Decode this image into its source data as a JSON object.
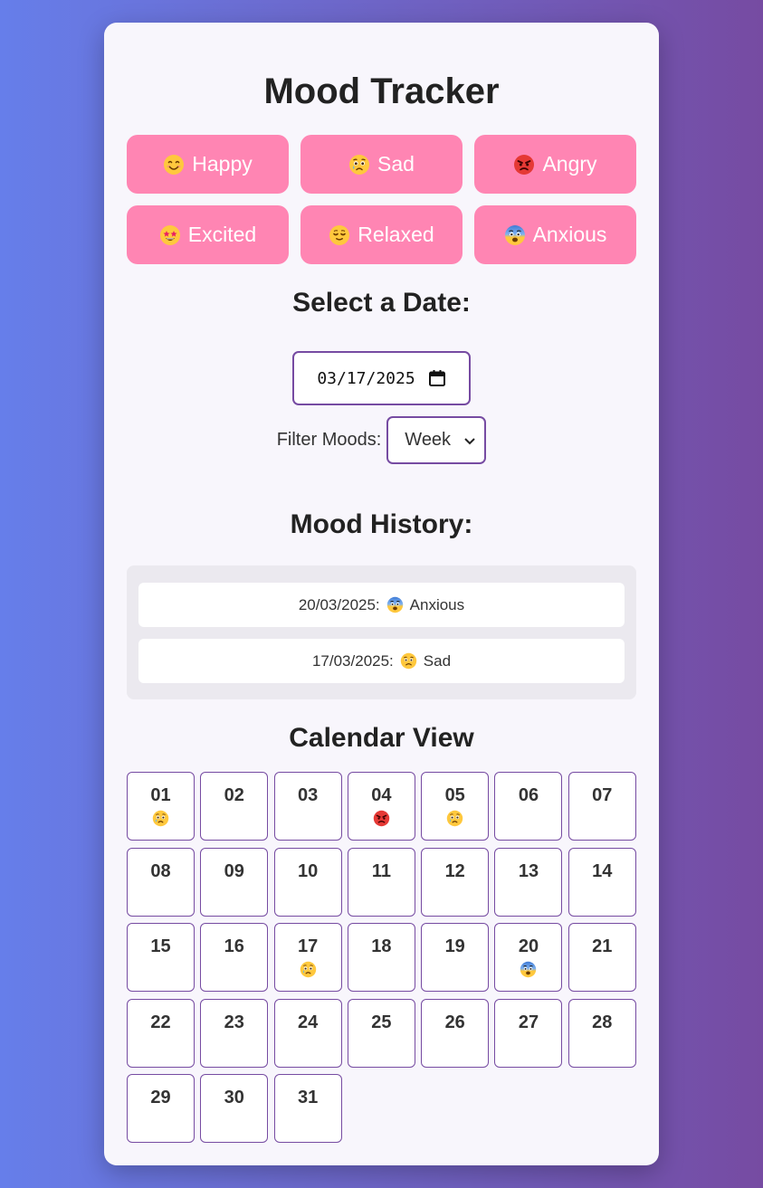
{
  "app": {
    "title": "Mood Tracker"
  },
  "moods": [
    {
      "label": "Happy",
      "icon": "smiling-face-icon"
    },
    {
      "label": "Sad",
      "icon": "crying-face-icon"
    },
    {
      "label": "Angry",
      "icon": "angry-face-icon"
    },
    {
      "label": "Excited",
      "icon": "star-struck-face-icon"
    },
    {
      "label": "Relaxed",
      "icon": "relieved-face-icon"
    },
    {
      "label": "Anxious",
      "icon": "fearful-face-icon"
    }
  ],
  "date_section": {
    "title": "Select a Date:",
    "value": "03/17/2025",
    "icon": "calendar-icon"
  },
  "filter": {
    "label": "Filter Moods:",
    "selected": "Week"
  },
  "history": {
    "title": "Mood History:",
    "entries": [
      {
        "date": "20/03/2025:",
        "mood": "Anxious",
        "icon": "fearful-face-icon"
      },
      {
        "date": "17/03/2025:",
        "mood": "Sad",
        "icon": "sad-face-icon"
      }
    ]
  },
  "calendar": {
    "title": "Calendar View",
    "days": [
      {
        "num": "01",
        "icon": "crying-face-icon"
      },
      {
        "num": "02",
        "icon": ""
      },
      {
        "num": "03",
        "icon": ""
      },
      {
        "num": "04",
        "icon": "angry-face-icon"
      },
      {
        "num": "05",
        "icon": "crying-face-icon"
      },
      {
        "num": "06",
        "icon": ""
      },
      {
        "num": "07",
        "icon": ""
      },
      {
        "num": "08",
        "icon": ""
      },
      {
        "num": "09",
        "icon": ""
      },
      {
        "num": "10",
        "icon": ""
      },
      {
        "num": "11",
        "icon": ""
      },
      {
        "num": "12",
        "icon": ""
      },
      {
        "num": "13",
        "icon": ""
      },
      {
        "num": "14",
        "icon": ""
      },
      {
        "num": "15",
        "icon": ""
      },
      {
        "num": "16",
        "icon": ""
      },
      {
        "num": "17",
        "icon": "crying-face-icon"
      },
      {
        "num": "18",
        "icon": ""
      },
      {
        "num": "19",
        "icon": ""
      },
      {
        "num": "20",
        "icon": "fearful-face-icon"
      },
      {
        "num": "21",
        "icon": ""
      },
      {
        "num": "22",
        "icon": ""
      },
      {
        "num": "23",
        "icon": ""
      },
      {
        "num": "24",
        "icon": ""
      },
      {
        "num": "25",
        "icon": ""
      },
      {
        "num": "26",
        "icon": ""
      },
      {
        "num": "27",
        "icon": ""
      },
      {
        "num": "28",
        "icon": ""
      },
      {
        "num": "29",
        "icon": ""
      },
      {
        "num": "30",
        "icon": ""
      },
      {
        "num": "31",
        "icon": ""
      }
    ]
  },
  "colors": {
    "accent": "#764ba2",
    "button": "#ff85b3",
    "gradient_start": "#667eea",
    "gradient_end": "#764ba2"
  }
}
